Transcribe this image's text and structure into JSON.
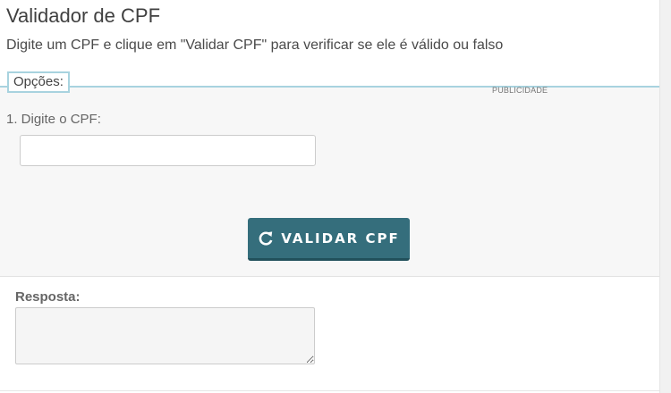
{
  "page": {
    "title": "Validador de CPF",
    "subtitle": "Digite um CPF e clique em \"Validar CPF\" para verificar se ele é válido ou falso"
  },
  "options": {
    "legend": "Opções:",
    "ad_label": "PUBLICIDADE",
    "field_label": "1. Digite o CPF:",
    "cpf_value": "",
    "button_label": "VALIDAR CPF"
  },
  "response": {
    "label": "Resposta:",
    "value": ""
  },
  "icons": {
    "button_icon": "refresh-icon"
  },
  "colors": {
    "button_bg": "#356e7c",
    "panel_border": "#a8d3df",
    "panel_bg": "#f7f7f7"
  }
}
